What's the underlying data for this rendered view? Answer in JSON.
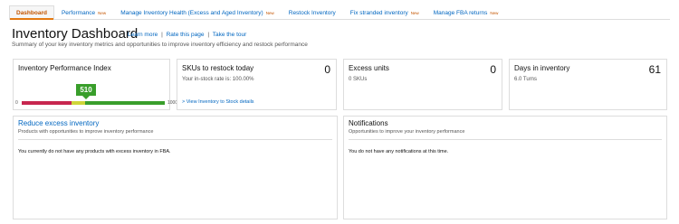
{
  "tabs": [
    {
      "label": "Dashboard",
      "badge": ""
    },
    {
      "label": "Performance",
      "badge": "New"
    },
    {
      "label": "Manage Inventory Health (Excess and Aged Inventory)",
      "badge": "New"
    },
    {
      "label": "Restock Inventory",
      "badge": ""
    },
    {
      "label": "Fix stranded inventory",
      "badge": "New"
    },
    {
      "label": "Manage FBA returns",
      "badge": "New"
    }
  ],
  "header": {
    "title": "Inventory Dashboard",
    "links": {
      "learn_more": "Learn more",
      "rate_page": "Rate this page",
      "take_tour": "Take the tour",
      "separator": "|"
    },
    "subtitle": "Summary of your key inventory metrics and opportunities to improve inventory efficiency and restock performance"
  },
  "ipi": {
    "title": "Inventory Performance Index",
    "score": "510",
    "min": "0",
    "max": "1000"
  },
  "restock": {
    "title": "SKUs to restock today",
    "value": "0",
    "subtitle": "Your in-stock rate is: 100.00%",
    "link": "> View Inventory to Stock details"
  },
  "excess": {
    "title": "Excess units",
    "value": "0",
    "subtitle": "0 SKUs"
  },
  "days": {
    "title": "Days in inventory",
    "value": "61",
    "subtitle": "6.0 Turns"
  },
  "reduce_panel": {
    "title": "Reduce excess inventory",
    "subtitle": "Products with opportunities to improve inventory performance",
    "message": "You currently do not have any products with excess inventory in FBA."
  },
  "notifications_panel": {
    "title": "Notifications",
    "subtitle": "Opportunities to improve your inventory performance",
    "message": "You do not have any notifications at this time."
  },
  "colors": {
    "link": "#0066c0",
    "active_tab": "#c45500",
    "tab_accent": "#e47911",
    "ipi_red": "#c7264f",
    "ipi_yellow": "#cfd63a",
    "ipi_green": "#399e2b"
  }
}
